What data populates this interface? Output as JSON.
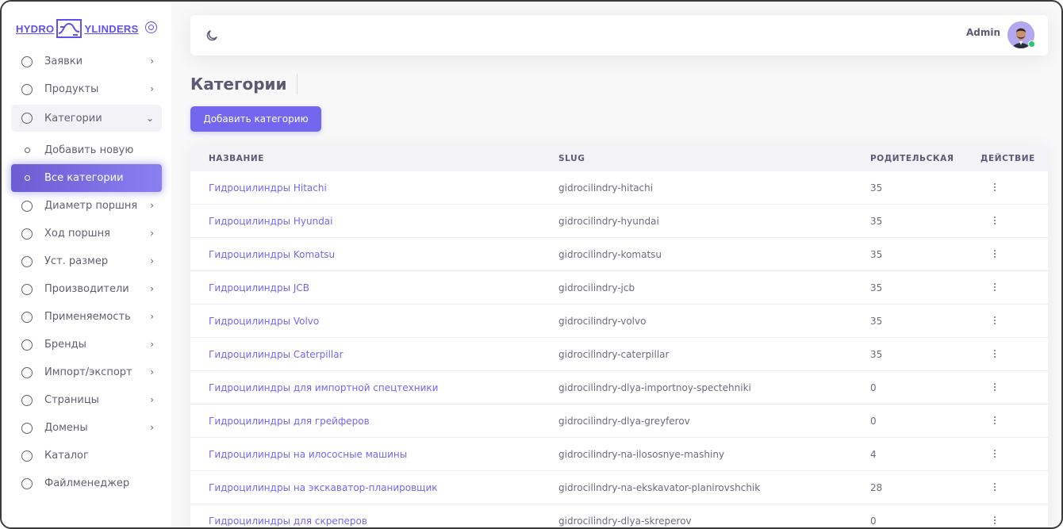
{
  "brand": {
    "left": "HYDRO",
    "right": "YLINDERS"
  },
  "sidebar": {
    "items_top": [
      {
        "label": "Заявки",
        "name": "sidebar-item-zayavki"
      },
      {
        "label": "Продукты",
        "name": "sidebar-item-produkty"
      }
    ],
    "open_item": {
      "label": "Категории",
      "name": "sidebar-item-kategorii"
    },
    "sub_items": [
      {
        "label": "Добавить новую",
        "name": "sidebar-subitem-add-new",
        "active": false
      },
      {
        "label": "Все категории",
        "name": "sidebar-subitem-all-categories",
        "active": true
      }
    ],
    "items_bottom": [
      {
        "label": "Диаметр поршня",
        "name": "sidebar-item-diametr",
        "chevron": true
      },
      {
        "label": "Ход поршня",
        "name": "sidebar-item-hod",
        "chevron": true
      },
      {
        "label": "Уст. размер",
        "name": "sidebar-item-ust-razmer",
        "chevron": true
      },
      {
        "label": "Производители",
        "name": "sidebar-item-proizvoditeli",
        "chevron": true
      },
      {
        "label": "Применяемость",
        "name": "sidebar-item-primenyaemost",
        "chevron": true
      },
      {
        "label": "Бренды",
        "name": "sidebar-item-brendy",
        "chevron": true
      },
      {
        "label": "Импорт/экспорт",
        "name": "sidebar-item-import-export",
        "chevron": true
      },
      {
        "label": "Страницы",
        "name": "sidebar-item-stranicy",
        "chevron": true
      },
      {
        "label": "Домены",
        "name": "sidebar-item-domeny",
        "chevron": true
      },
      {
        "label": "Каталог",
        "name": "sidebar-item-katalog",
        "chevron": false
      },
      {
        "label": "Файлменеджер",
        "name": "sidebar-item-filemanager",
        "chevron": false
      }
    ]
  },
  "topbar": {
    "user_name": "Admin"
  },
  "main": {
    "title": "Категории",
    "add_button_label": "Добавить категорию"
  },
  "table": {
    "headers": {
      "name": "НАЗВАНИЕ",
      "slug": "SLUG",
      "parent": "РОДИТЕЛЬСКАЯ",
      "action": "ДЕЙСТВИЕ"
    },
    "rows": [
      {
        "name": "Гидроцилиндры Hitachi",
        "slug": "gidrocilindry-hitachi",
        "parent": "35"
      },
      {
        "name": "Гидроцилиндры Hyundai",
        "slug": "gidrocilindry-hyundai",
        "parent": "35"
      },
      {
        "name": "Гидроцилиндры Komatsu",
        "slug": "gidrocilindry-komatsu",
        "parent": "35"
      },
      {
        "name": "Гидроцилиндры JCB",
        "slug": "gidrocilindry-jcb",
        "parent": "35"
      },
      {
        "name": "Гидроцилиндры Volvo",
        "slug": "gidrocilindry-volvo",
        "parent": "35"
      },
      {
        "name": "Гидроцилиндры Caterpillar",
        "slug": "gidrocilindry-caterpillar",
        "parent": "35"
      },
      {
        "name": "Гидроцилиндры для импортной спецтехники",
        "slug": "gidrocilindry-dlya-importnoy-spectehniki",
        "parent": "0"
      },
      {
        "name": "Гидроцилиндры для грейферов",
        "slug": "gidrocilindry-dlya-greyferov",
        "parent": "0"
      },
      {
        "name": "Гидроцилиндры на илососные машины",
        "slug": "gidrocilindry-na-ilososnye-mashiny",
        "parent": "4"
      },
      {
        "name": "Гидроцилиндры на экскаватор-планировщик",
        "slug": "gidrocilindry-na-ekskavator-planirovshchik",
        "parent": "28"
      },
      {
        "name": "Гидроцилиндры для скреперов",
        "slug": "gidrocilindry-dlya-skreperov",
        "parent": "0"
      }
    ]
  },
  "colors": {
    "accent": "#7367f0",
    "online": "#28c76f"
  },
  "icons": [
    "moon-icon",
    "avatar",
    "kebab-icon",
    "chevron-right-icon",
    "chevron-down-icon",
    "circle-icon"
  ]
}
